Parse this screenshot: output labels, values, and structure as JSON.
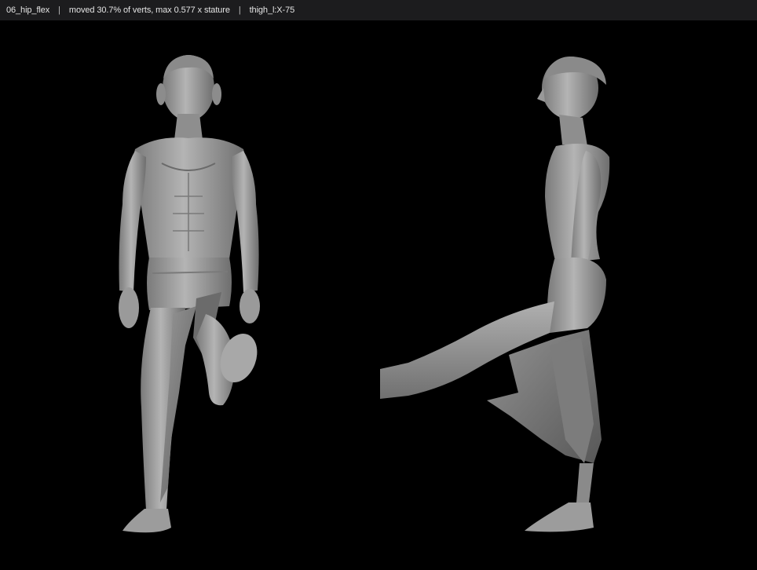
{
  "header": {
    "pose_name": "06_hip_flex",
    "separator": "|",
    "stats": "moved 30.7% of verts, max 0.577 x stature",
    "joint": "thigh_l:X-75"
  }
}
